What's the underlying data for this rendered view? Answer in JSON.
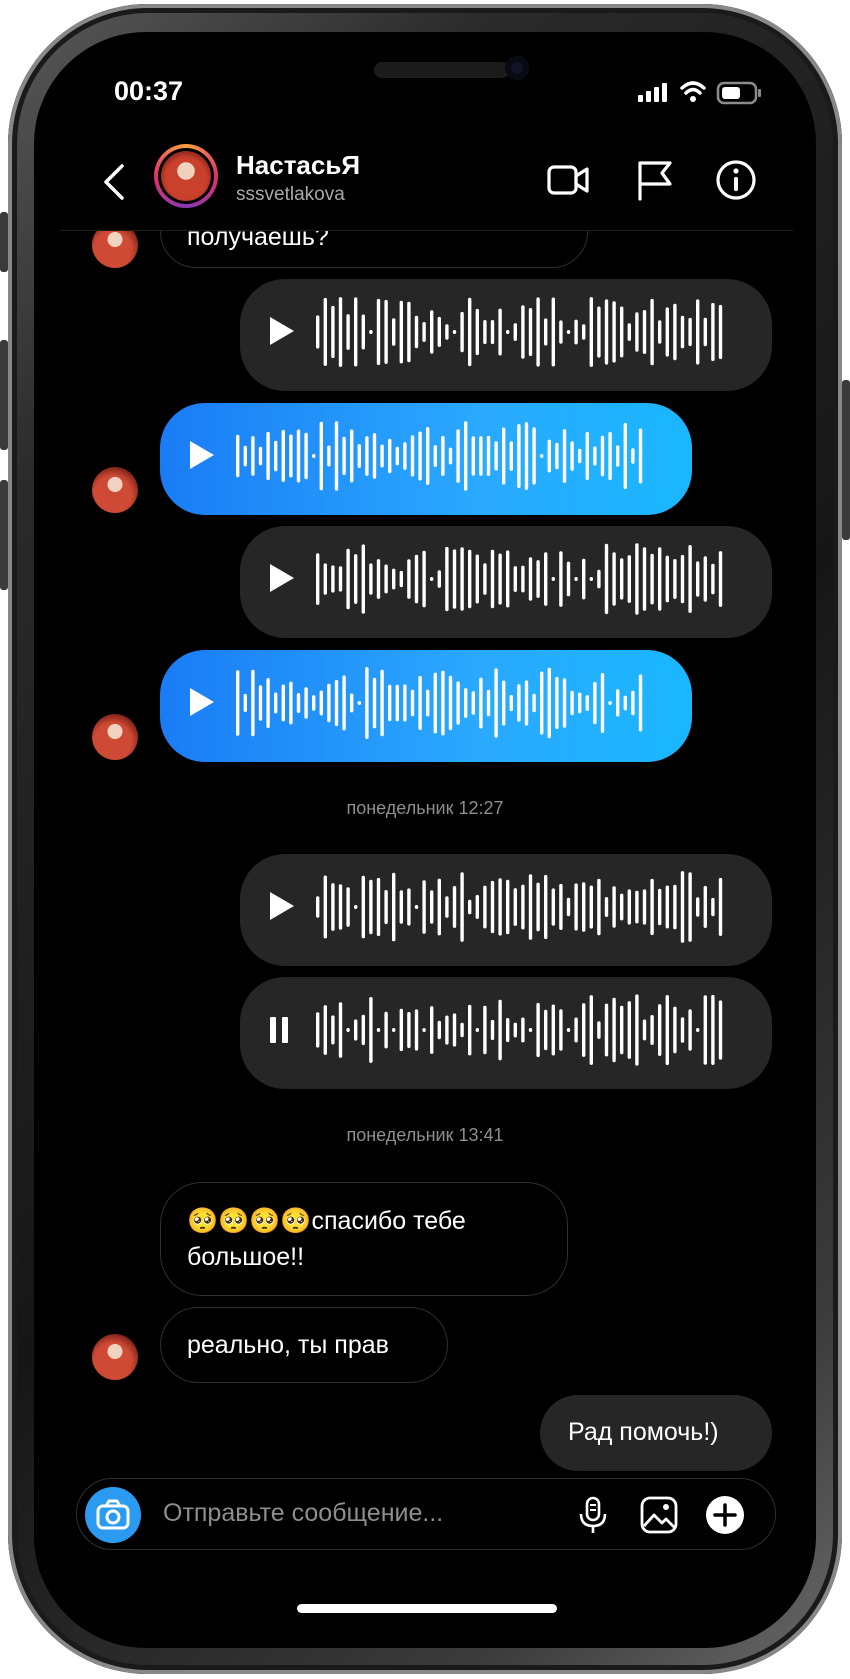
{
  "status": {
    "time": "00:37"
  },
  "header": {
    "name": "НастасьЯ",
    "username": "sssvetlakova"
  },
  "messages": {
    "top_partial": "получаешь?",
    "timestamp1": "понедельник 12:27",
    "timestamp2": "понедельник 13:41",
    "incoming1": "🥺🥺🥺🥺спасибо тебе большое!!",
    "incoming2": "реально, ты прав",
    "outgoing1": "Рад помочь!)"
  },
  "composer": {
    "placeholder": "Отправьте сообщение..."
  },
  "colors": {
    "accent_blue": "#1a9cff",
    "outgoing_bubble": "#262626",
    "background": "#000000"
  },
  "icons": [
    "back-icon",
    "video-call-icon",
    "flag-icon",
    "info-icon",
    "play-icon",
    "pause-icon",
    "camera-icon",
    "microphone-icon",
    "gallery-icon",
    "plus-icon"
  ]
}
